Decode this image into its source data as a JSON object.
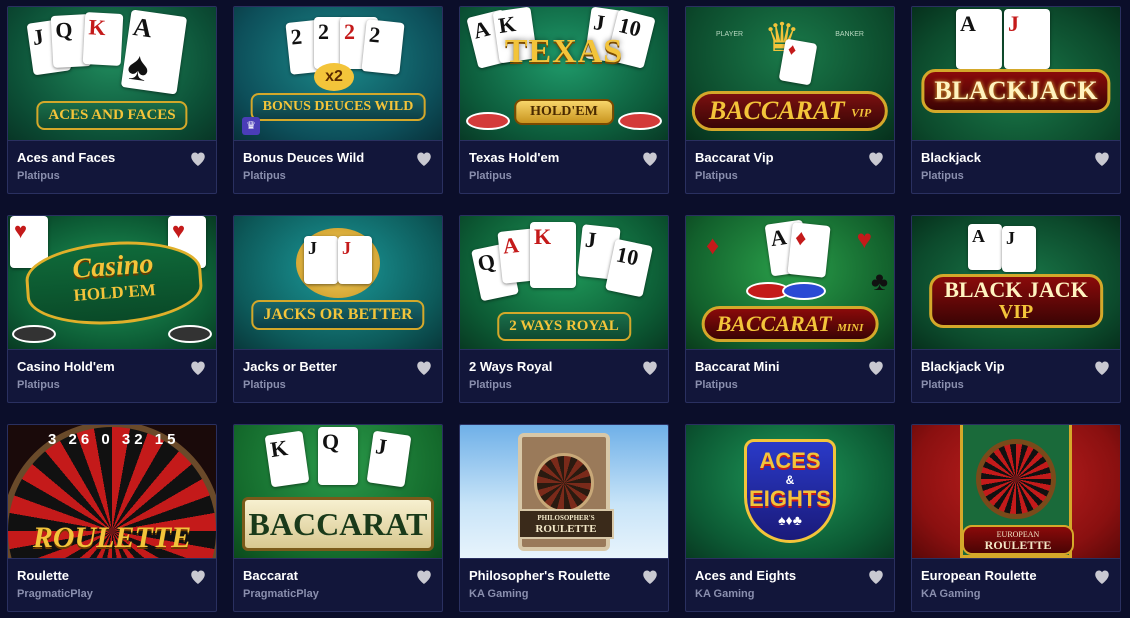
{
  "games": [
    {
      "title": "Aces and Faces",
      "provider": "Platipus",
      "art": "ACES AND FACES"
    },
    {
      "title": "Bonus Deuces Wild",
      "provider": "Platipus",
      "art": "BONUS DEUCES WILD"
    },
    {
      "title": "Texas Hold'em",
      "provider": "Platipus",
      "art": "TEXAS",
      "art2": "HOLD'EM"
    },
    {
      "title": "Baccarat Vip",
      "provider": "Platipus",
      "art": "BACCARAT",
      "art2": "VIP"
    },
    {
      "title": "Blackjack",
      "provider": "Platipus",
      "art": "BLACKJACK"
    },
    {
      "title": "Casino Hold'em",
      "provider": "Platipus",
      "art": "Casino",
      "art2": "HOLD'EM"
    },
    {
      "title": "Jacks or Better",
      "provider": "Platipus",
      "art": "JACKS OR BETTER"
    },
    {
      "title": "2 Ways Royal",
      "provider": "Platipus",
      "art": "2 WAYS ROYAL"
    },
    {
      "title": "Baccarat Mini",
      "provider": "Platipus",
      "art": "BACCARAT",
      "art2": "MINI"
    },
    {
      "title": "Blackjack Vip",
      "provider": "Platipus",
      "art": "BLACK JACK",
      "art2": "VIP"
    },
    {
      "title": "Roulette",
      "provider": "PragmaticPlay",
      "art": "ROULETTE"
    },
    {
      "title": "Baccarat",
      "provider": "PragmaticPlay",
      "art": "BACCARAT"
    },
    {
      "title": "Philosopher's Roulette",
      "provider": "KA Gaming",
      "art": "PHILOSOPHER'S",
      "art2": "ROULETTE"
    },
    {
      "title": "Aces and Eights",
      "provider": "KA Gaming",
      "art": "ACES",
      "art2": "EIGHTS"
    },
    {
      "title": "European Roulette",
      "provider": "KA Gaming",
      "art": "EUROPEAN",
      "art2": "ROULETTE"
    }
  ],
  "art_extra": {
    "x2": "x2",
    "player": "PLAYER",
    "banker": "BANKER",
    "and": "&",
    "roulette_numbers": "3 26 0 32 15"
  },
  "colors": {
    "page_bg": "#0b0e2a",
    "card_bg": "#12163a",
    "heart": "#c9c9d1",
    "gold": "#f3c43a"
  }
}
